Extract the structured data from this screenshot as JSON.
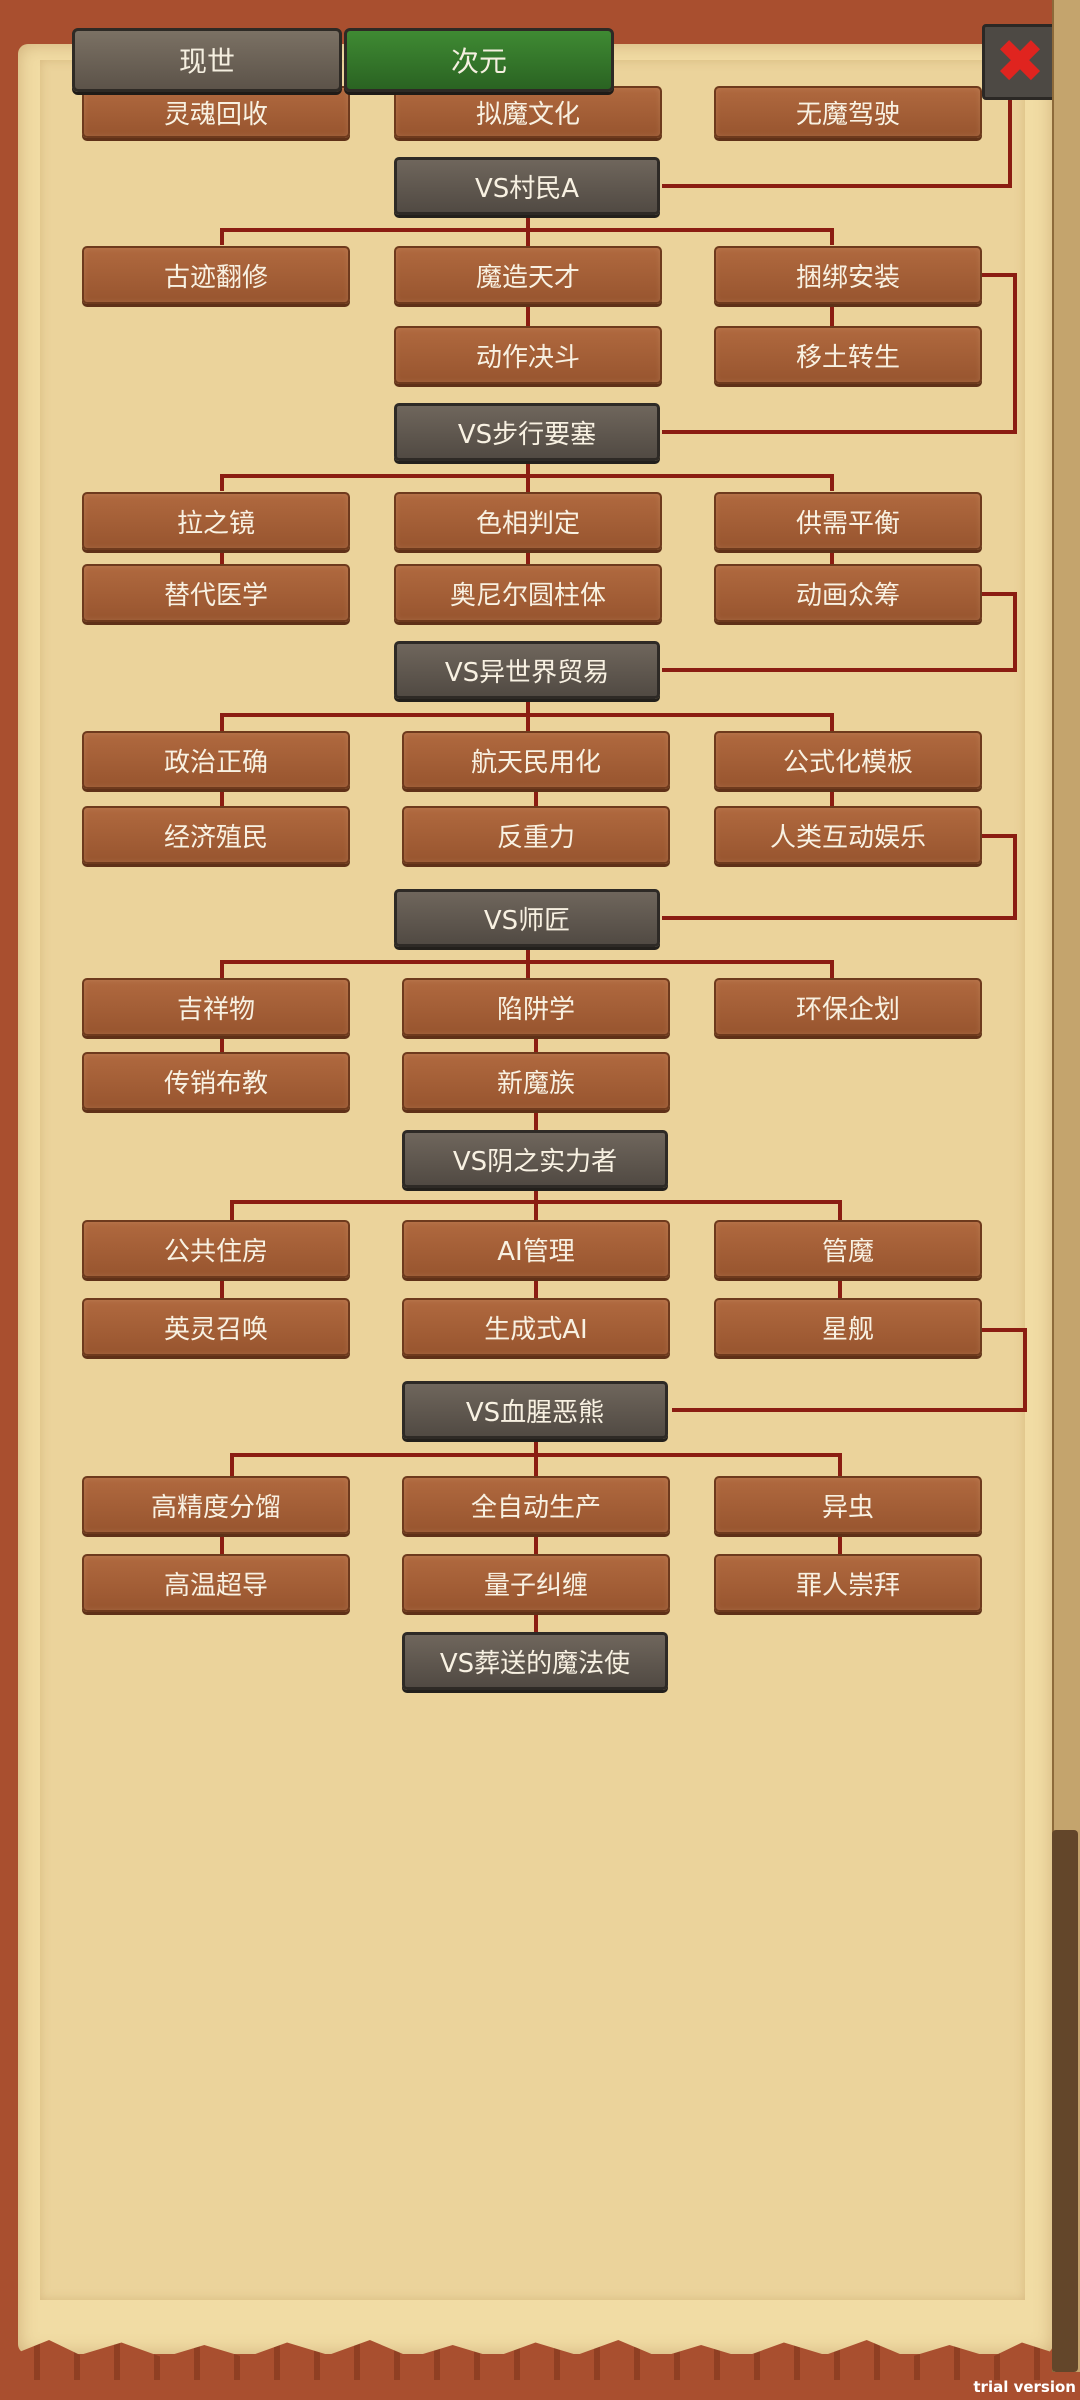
{
  "tabs": {
    "real": "现世",
    "anime": "次元"
  },
  "close_button": "close-icon",
  "watermark": "trial version",
  "tree": {
    "row0": [
      "灵魂回收",
      "拟魔文化",
      "无魔驾驶"
    ],
    "vs1": "VS村民A",
    "g1_row1": [
      "古迹翻修",
      "魔造天才",
      "捆绑安装"
    ],
    "g1_row2": [
      "动作决斗",
      "移土转生"
    ],
    "vs2": "VS步行要塞",
    "g2_row1": [
      "拉之镜",
      "色相判定",
      "供需平衡"
    ],
    "g2_row2": [
      "替代医学",
      "奥尼尔圆柱体",
      "动画众筹"
    ],
    "vs3": "VS异世界贸易",
    "g3_row1": [
      "政治正确",
      "航天民用化",
      "公式化模板"
    ],
    "g3_row2": [
      "经济殖民",
      "反重力",
      "人类互动娱乐"
    ],
    "vs4": "VS师匠",
    "g4_row1": [
      "吉祥物",
      "陷阱学",
      "环保企划"
    ],
    "g4_row2": [
      "传销布教",
      "新魔族"
    ],
    "vs5": "VS阴之实力者",
    "g5_row1": [
      "公共住房",
      "AI管理",
      "管魔"
    ],
    "g5_row2": [
      "英灵召唤",
      "生成式AI",
      "星舰"
    ],
    "vs6": "VS血腥恶熊",
    "g6_row1": [
      "高精度分馏",
      "全自动生产",
      "异虫"
    ],
    "g6_row2": [
      "高温超导",
      "量子纠缠",
      "罪人崇拜"
    ],
    "vs7": "VS葬送的魔法使"
  },
  "colors": {
    "connector": "#8b1d12",
    "wood": "#a55f36",
    "boss": "#5e564d",
    "tab_active": "#336f28"
  }
}
